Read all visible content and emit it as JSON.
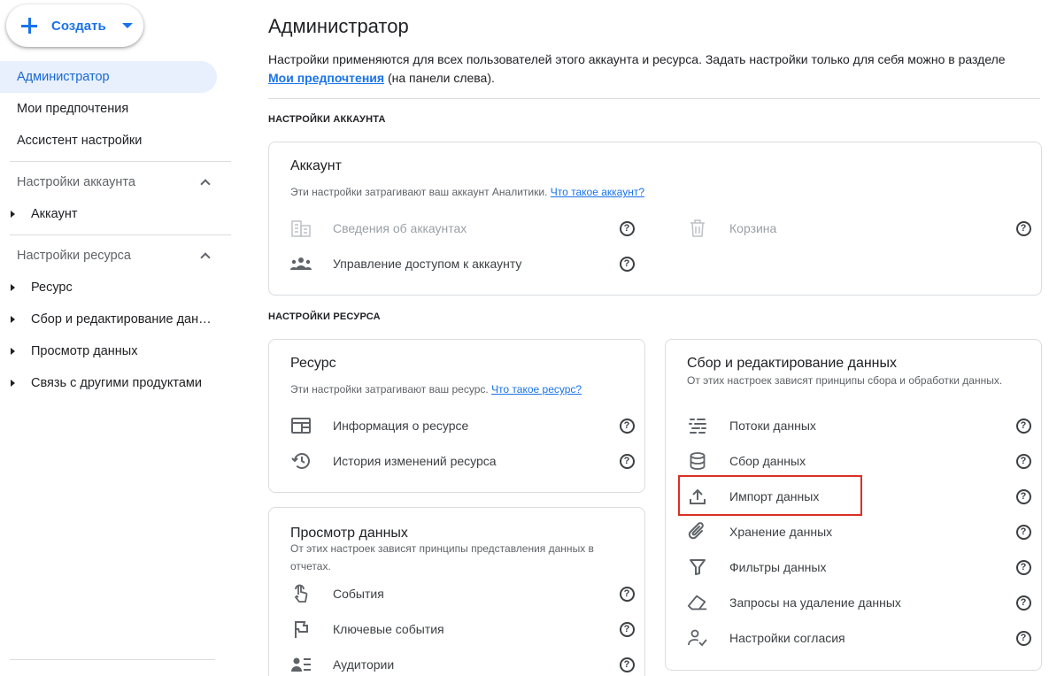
{
  "sidebar": {
    "create_label": "Создать",
    "admin": "Администратор",
    "my_prefs": "Мои предпочтения",
    "assistant": "Ассистент настройки",
    "account_settings": "Настройки аккаунта",
    "account_items": [
      "Аккаунт"
    ],
    "property_settings": "Настройки ресурса",
    "property_items": [
      "Ресурс",
      "Сбор и редактирование данных",
      "Просмотр данных",
      "Связь с другими продуктами"
    ]
  },
  "main": {
    "title": "Администратор",
    "desc_prefix": "Настройки применяются для всех пользователей этого аккаунта и ресурса. Задать настройки только для себя можно в разделе",
    "desc_link": "Мои предпочтения",
    "desc_suffix": "(на панели слева).",
    "section_account": "НАСТРОЙКИ АККАУНТА",
    "section_property": "НАСТРОЙКИ РЕСУРСА"
  },
  "account_card": {
    "title": "Аккаунт",
    "sub": "Эти настройки затрагивают ваш аккаунт Аналитики.",
    "sub_link": "Что такое аккаунт?",
    "rows": [
      {
        "label": "Сведения об аккаунтах",
        "icon": "building-icon"
      },
      {
        "label": "Управление доступом к аккаунту",
        "icon": "people-icon"
      },
      {
        "label": "Корзина",
        "icon": "trash-icon"
      }
    ]
  },
  "property_card": {
    "title": "Ресурс",
    "sub": "Эти настройки затрагивают ваш ресурс.",
    "sub_link": "Что такое ресурс?",
    "rows": [
      {
        "label": "Информация о ресурсе",
        "icon": "property-info-icon"
      },
      {
        "label": "История изменений ресурса",
        "icon": "history-icon"
      }
    ]
  },
  "display_card": {
    "title": "Просмотр данных",
    "sub": "От этих настроек зависят принципы представления данных в отчетах.",
    "rows": [
      {
        "label": "События",
        "icon": "touch-icon"
      },
      {
        "label": "Ключевые события",
        "icon": "flag-icon"
      },
      {
        "label": "Аудитории",
        "icon": "audience-icon"
      }
    ]
  },
  "collection_card": {
    "title": "Сбор и редактирование данных",
    "sub": "От этих настроек зависят принципы сбора и обработки данных.",
    "rows": [
      {
        "label": "Потоки данных",
        "icon": "streams-icon"
      },
      {
        "label": "Сбор данных",
        "icon": "database-icon"
      },
      {
        "label": "Импорт данных",
        "icon": "upload-icon"
      },
      {
        "label": "Хранение данных",
        "icon": "paperclip-icon"
      },
      {
        "label": "Фильтры данных",
        "icon": "filter-icon"
      },
      {
        "label": "Запросы на удаление данных",
        "icon": "eraser-icon"
      },
      {
        "label": "Настройки согласия",
        "icon": "consent-icon"
      }
    ]
  },
  "help_glyph": "?",
  "colors": {
    "accent": "#1a73e8",
    "active_bg": "#e8f0fe",
    "highlight": "#d93025"
  }
}
